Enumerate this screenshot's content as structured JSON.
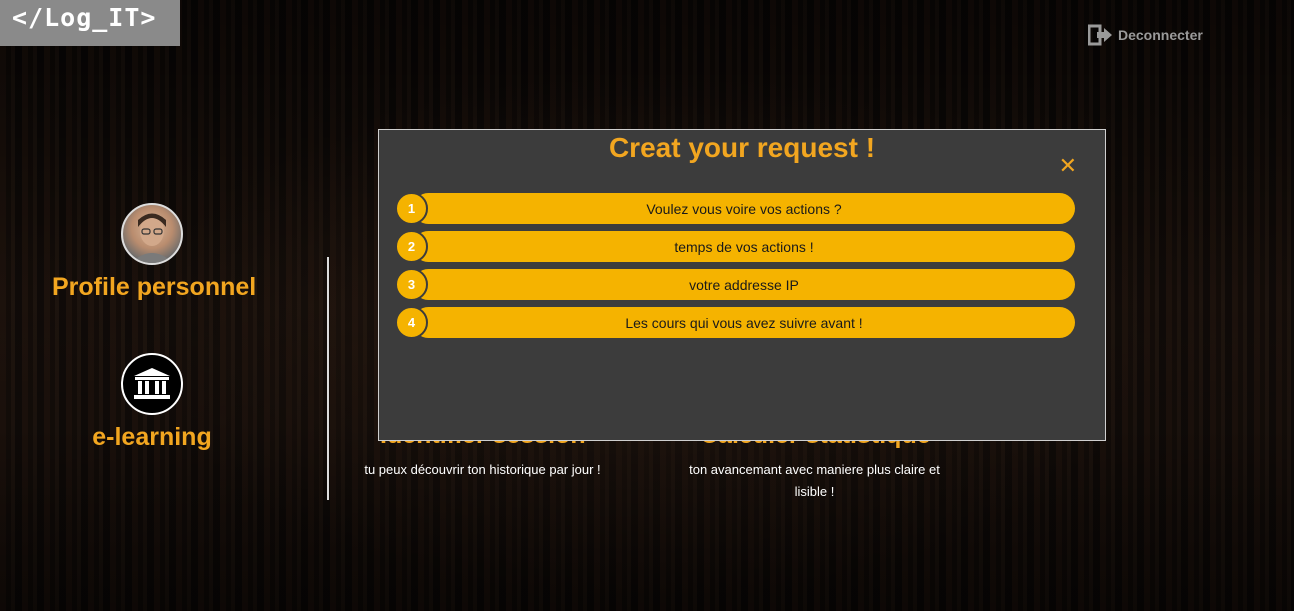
{
  "logo": {
    "text": "</Log_IT>"
  },
  "header": {
    "logout_label": "Deconnecter"
  },
  "sidebar": {
    "items": [
      {
        "label": "Profile personnel",
        "icon": "user-avatar"
      },
      {
        "label": "e-learning",
        "icon": "institution-icon"
      }
    ]
  },
  "features": [
    {
      "title": "Identifier session",
      "desc": "tu peux découvrir ton historique par jour !"
    },
    {
      "title": "Calculer statistique",
      "desc": "ton avancemant avec maniere plus claire et lisible !"
    }
  ],
  "modal": {
    "title": "Creat your request !",
    "close_glyph": "✕",
    "requests": [
      {
        "num": "1",
        "label": "Voulez vous voire vos actions ?"
      },
      {
        "num": "2",
        "label": "temps de vos actions !"
      },
      {
        "num": "3",
        "label": "votre addresse IP"
      },
      {
        "num": "4",
        "label": "Les cours qui vous avez suivre avant !"
      }
    ]
  },
  "colors": {
    "accent": "#f2a620",
    "bar": "#f5b300",
    "modal_bg": "#3c3c3c"
  }
}
